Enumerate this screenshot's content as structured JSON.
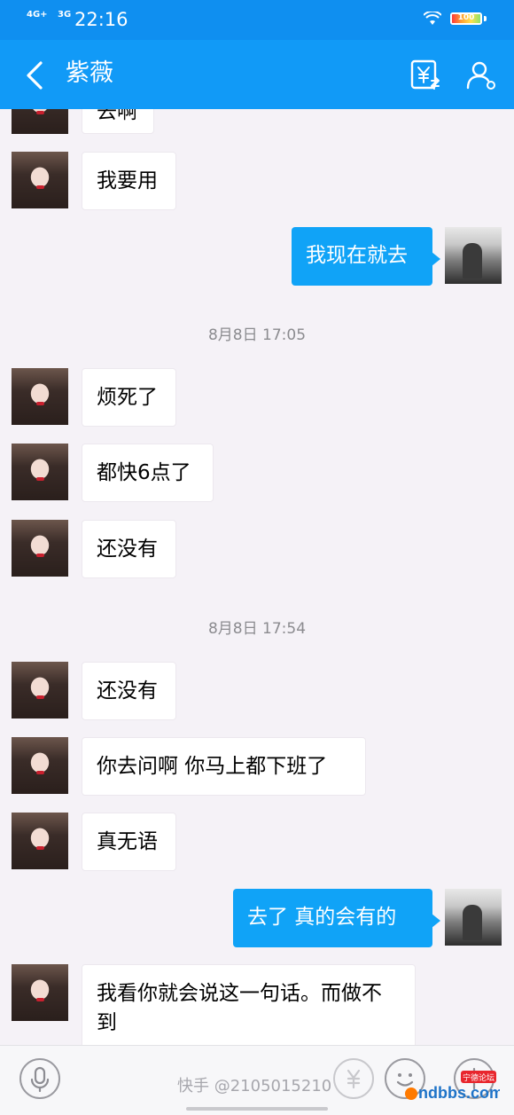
{
  "status_bar": {
    "network_1": "4G+",
    "network_2": "3G",
    "time": "22:16",
    "battery_level": "100"
  },
  "header": {
    "contact_name": "紫薇",
    "back_icon": "chevron-left-icon",
    "transfer_icon": "yuan-transfer-icon",
    "profile_icon": "person-icon"
  },
  "messages": [
    {
      "side": "in",
      "text": "去啊"
    },
    {
      "side": "in",
      "text": "我要用"
    },
    {
      "side": "out",
      "text": "我现在就去"
    },
    {
      "side": "timestamp",
      "text": "8月8日 17:05"
    },
    {
      "side": "in",
      "text": "烦死了"
    },
    {
      "side": "in",
      "text": "都快6点了"
    },
    {
      "side": "in",
      "text": "还没有"
    },
    {
      "side": "timestamp",
      "text": "8月8日 17:54"
    },
    {
      "side": "in",
      "text": "还没有"
    },
    {
      "side": "in",
      "text": "你去问啊 你马上都下班了"
    },
    {
      "side": "in",
      "text": "真无语"
    },
    {
      "side": "out",
      "text": "去了 真的会有的"
    },
    {
      "side": "in",
      "text": "我看你就会说这一句话。而做不到"
    }
  ],
  "input_bar": {
    "voice_icon": "microphone-icon",
    "watermark": "快手 @2105015210",
    "red_packet_icon": "yuan-icon",
    "emoji_icon": "smiley-icon",
    "plus_icon": "plus-icon",
    "logo_text": "ndbbs.com",
    "logo_tag": "宁德论坛"
  },
  "colors": {
    "header_blue": "#119af7",
    "status_blue": "#0f8ff0",
    "outgoing_bubble": "#10a3f7",
    "chat_background": "#f5f2f7"
  }
}
